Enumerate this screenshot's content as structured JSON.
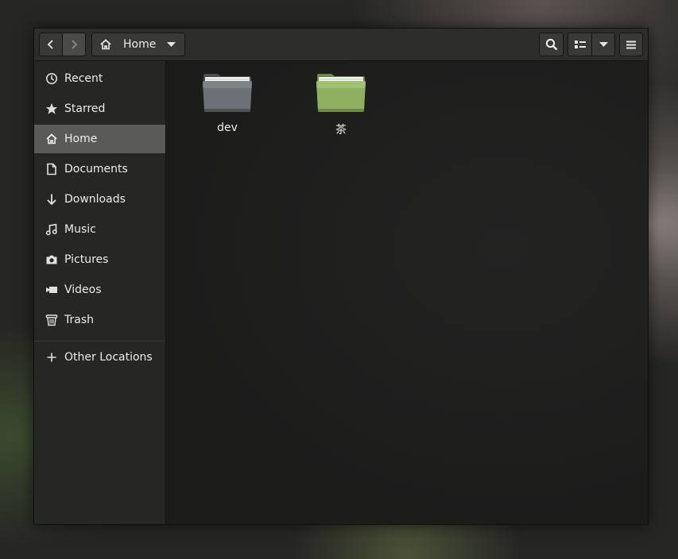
{
  "header": {
    "location_label": "Home",
    "icons": {
      "back": "chevron-left-icon",
      "forward": "chevron-right-icon",
      "home": "home-icon",
      "location_menu": "dropdown-arrow-icon",
      "search": "search-icon",
      "view": "list-view-icon",
      "view_menu": "dropdown-arrow-icon",
      "menu": "hamburger-menu-icon"
    }
  },
  "sidebar": {
    "items": [
      {
        "label": "Recent",
        "icon": "clock-icon"
      },
      {
        "label": "Starred",
        "icon": "star-icon"
      },
      {
        "label": "Home",
        "icon": "home-icon",
        "selected": true
      },
      {
        "label": "Documents",
        "icon": "document-icon"
      },
      {
        "label": "Downloads",
        "icon": "download-arrow-icon"
      },
      {
        "label": "Music",
        "icon": "music-note-icon"
      },
      {
        "label": "Pictures",
        "icon": "camera-icon"
      },
      {
        "label": "Videos",
        "icon": "video-camera-icon"
      },
      {
        "label": "Trash",
        "icon": "trash-icon"
      }
    ],
    "other_locations": {
      "label": "Other Locations",
      "icon": "plus-icon"
    }
  },
  "files": [
    {
      "name": "dev",
      "icon": "folder-icon",
      "color": "#6b7174"
    },
    {
      "name": "茶",
      "icon": "folder-icon",
      "color": "#8fb060"
    }
  ],
  "colors": {
    "selected_bg": "#5a5a58",
    "window_bg": "#1f1f1e",
    "sidebar_bg": "#262625",
    "headerbar_bg": "#2d2d2b"
  }
}
